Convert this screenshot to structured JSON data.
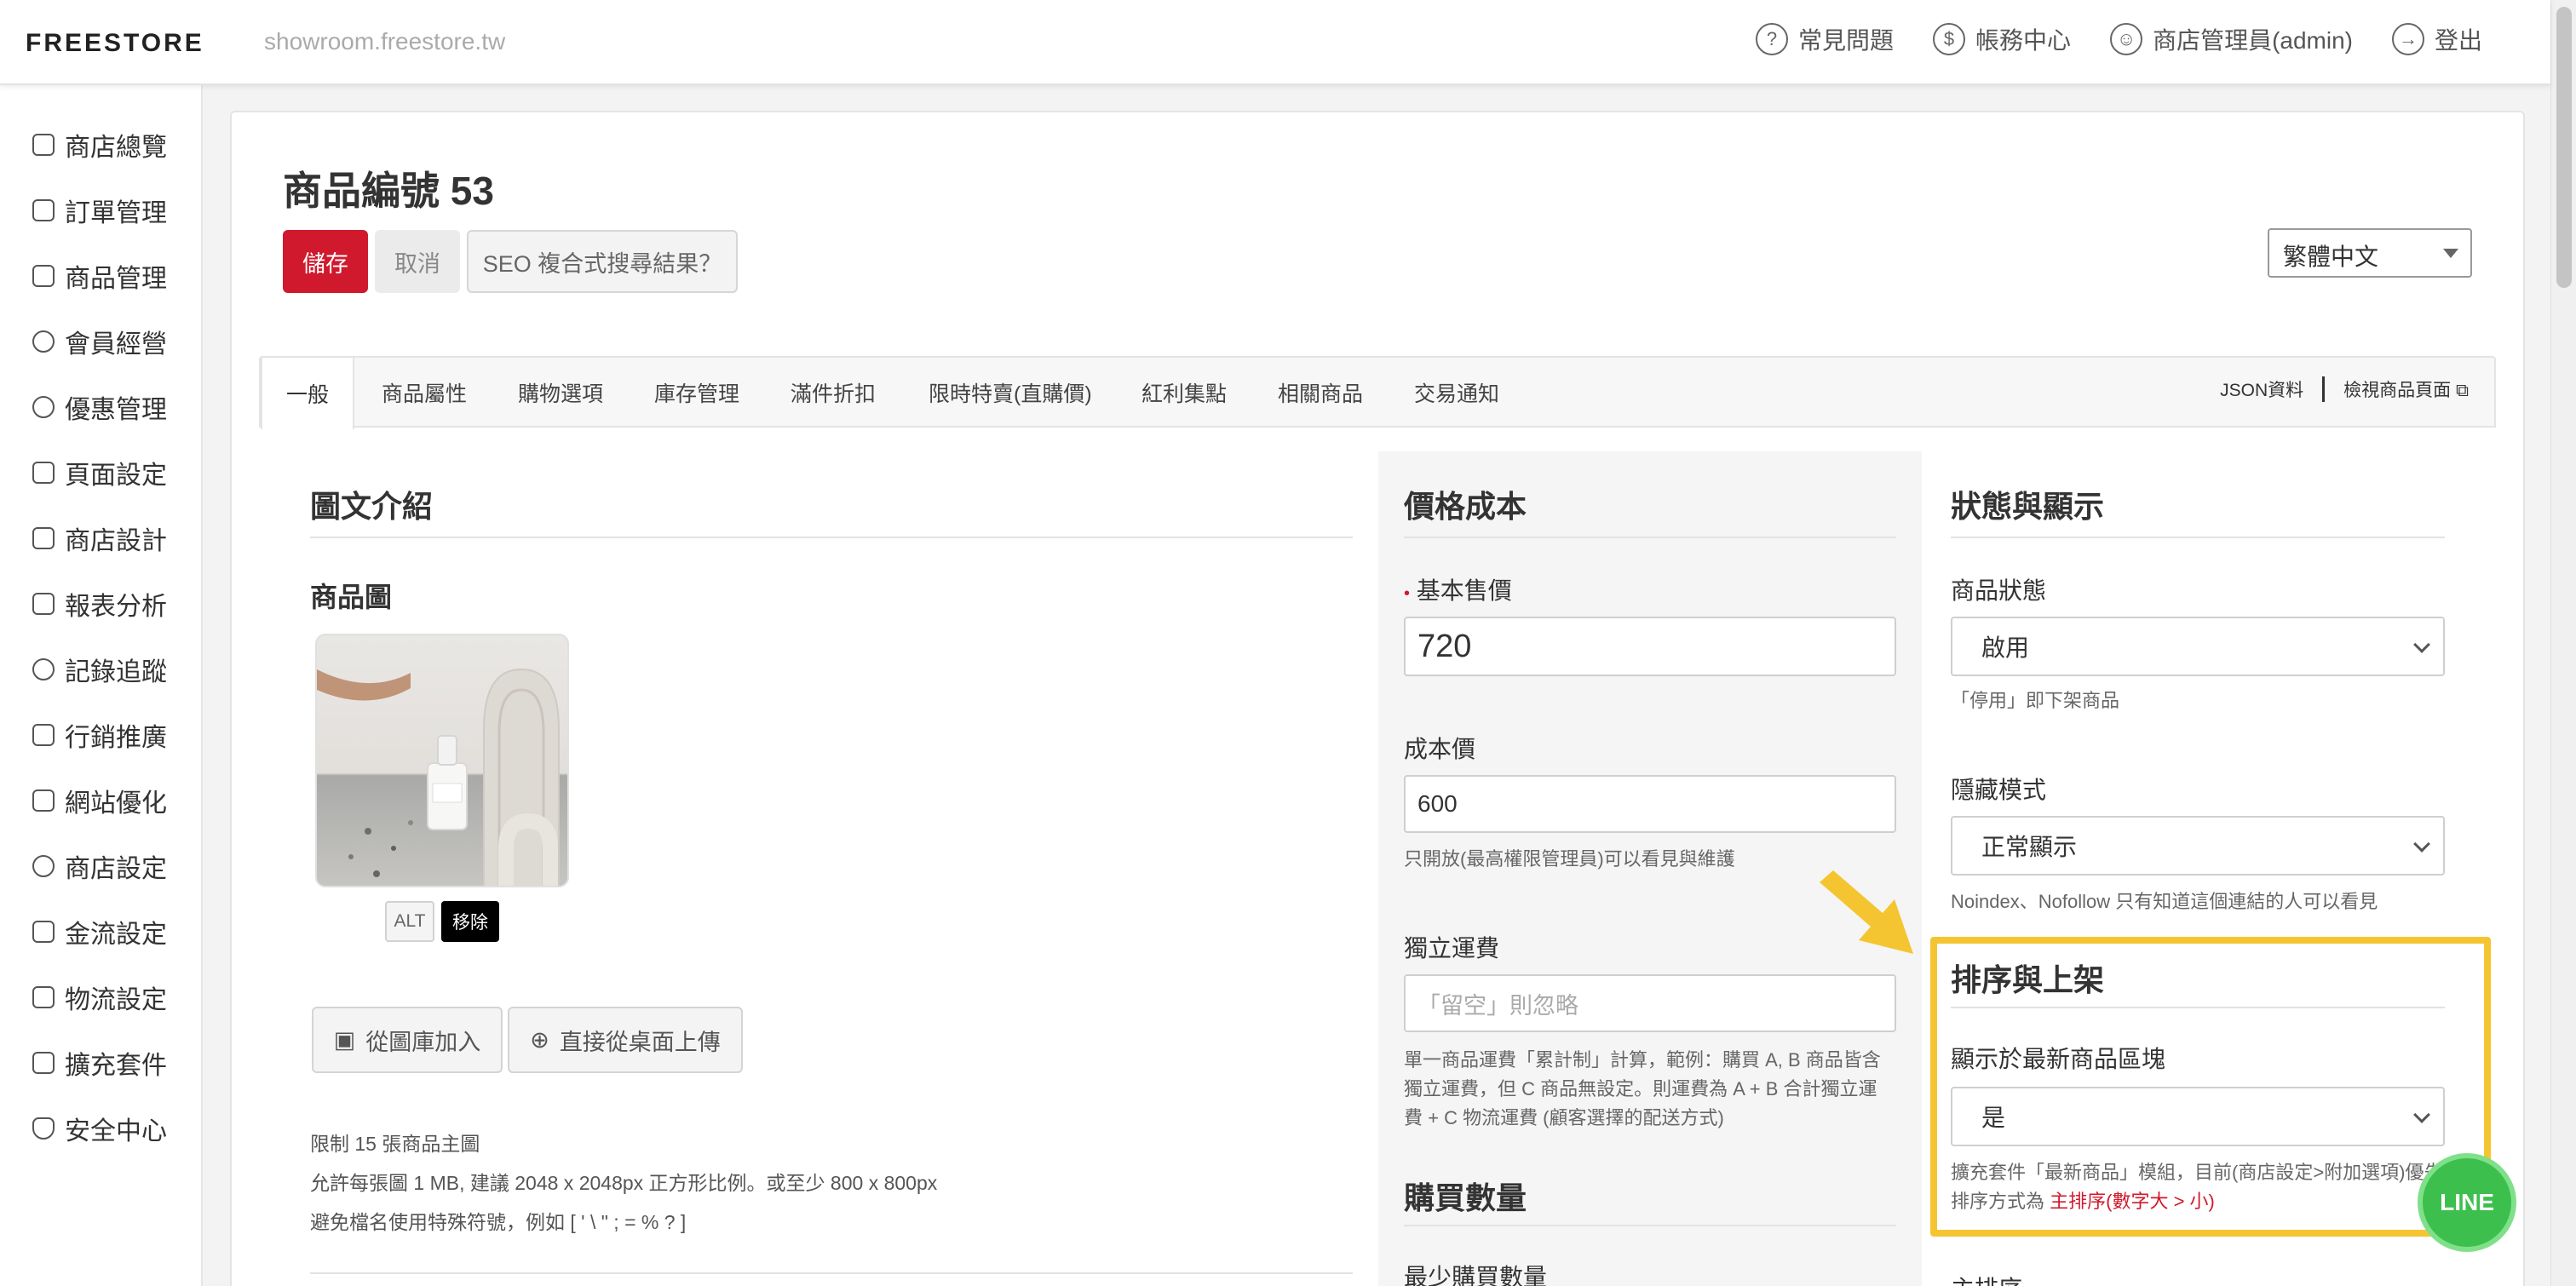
{
  "header": {
    "logo": "FREESTORE",
    "domain": "showroom.freestore.tw",
    "nav": [
      {
        "label": "常見問題",
        "icon": "question-icon"
      },
      {
        "label": "帳務中心",
        "icon": "dollar-icon"
      },
      {
        "label": "商店管理員(admin)",
        "icon": "user-icon"
      },
      {
        "label": "登出",
        "icon": "logout-icon"
      }
    ]
  },
  "sidebar": {
    "items": [
      {
        "label": "商店總覽",
        "icon": "grid-icon"
      },
      {
        "label": "訂單管理",
        "icon": "basket-icon"
      },
      {
        "label": "商品管理",
        "icon": "clipboard-icon"
      },
      {
        "label": "會員經營",
        "icon": "person-icon"
      },
      {
        "label": "優惠管理",
        "icon": "badge-icon"
      },
      {
        "label": "頁面設定",
        "icon": "page-icon"
      },
      {
        "label": "商店設計",
        "icon": "paint-icon"
      },
      {
        "label": "報表分析",
        "icon": "chart-icon"
      },
      {
        "label": "記錄追蹤",
        "icon": "target-icon"
      },
      {
        "label": "行銷推廣",
        "icon": "megaphone-icon"
      },
      {
        "label": "網站優化",
        "icon": "monitor-icon"
      },
      {
        "label": "商店設定",
        "icon": "gear-icon"
      },
      {
        "label": "金流設定",
        "icon": "card-icon"
      },
      {
        "label": "物流設定",
        "icon": "truck-icon"
      },
      {
        "label": "擴充套件",
        "icon": "plugin-icon"
      },
      {
        "label": "安全中心",
        "icon": "shield-icon"
      }
    ]
  },
  "page": {
    "title": "商品編號 53",
    "save_label": "儲存",
    "cancel_label": "取消",
    "seo_label": "SEO 複合式搜尋結果？",
    "language": "繁體中文"
  },
  "tabs": {
    "items": [
      "一般",
      "商品屬性",
      "購物選項",
      "庫存管理",
      "滿件折扣",
      "限時特賣(直購價)",
      "紅利集點",
      "相關商品",
      "交易通知"
    ],
    "json_link": "JSON資料",
    "view_link": "檢視商品頁面"
  },
  "intro": {
    "title": "圖文介紹",
    "image_label": "商品圖",
    "alt_label": "ALT",
    "remove_label": "移除",
    "from_library": "從圖庫加入",
    "upload_desktop": "直接從桌面上傳",
    "notes": [
      "限制 15 張商品主圖",
      "允許每張圖 1 MB, 建議 2048 x 2048px 正方形比例。或至少 800 x 800px",
      "避免檔名使用特殊符號，例如 [ ' \\ \" ; = % ? ]"
    ]
  },
  "price": {
    "title": "價格成本",
    "base_label": "基本售價",
    "base_value": "720",
    "cost_label": "成本價",
    "cost_value": "600",
    "cost_help": "只開放(最高權限管理員)可以看見與維護",
    "shipping_label": "獨立運費",
    "shipping_placeholder": "「留空」則忽略",
    "shipping_help": [
      "單一商品運費「累計制」計算，範例：購買 A, B 商品皆含",
      "獨立運費，但 C 商品無設定。則運費為 A + B 合計獨立運",
      "費 + C 物流運費 (顧客選擇的配送方式)"
    ],
    "qty_title": "購買數量",
    "min_qty_label": "最少購買數量"
  },
  "status": {
    "title": "狀態與顯示",
    "status_label": "商品狀態",
    "status_value": "啟用",
    "status_help": "「停用」即下架商品",
    "hidden_label": "隱藏模式",
    "hidden_value": "正常顯示",
    "hidden_help": "Noindex、Nofollow 只有知道這個連結的人可以看見",
    "sort_title": "排序與上架",
    "newest_label": "顯示於最新商品區塊",
    "newest_value": "是",
    "newest_help": "擴充套件「最新商品」模組，目前(商店設定>附加選項)優先",
    "sort_prefix": "排序方式為",
    "sort_value": "主排序(數字大 > 小)",
    "main_sort_label": "主排序"
  },
  "line_button": "LINE",
  "colors": {
    "accent": "#d0192c",
    "highlight": "#f5c531",
    "line": "#3dbf4d"
  }
}
